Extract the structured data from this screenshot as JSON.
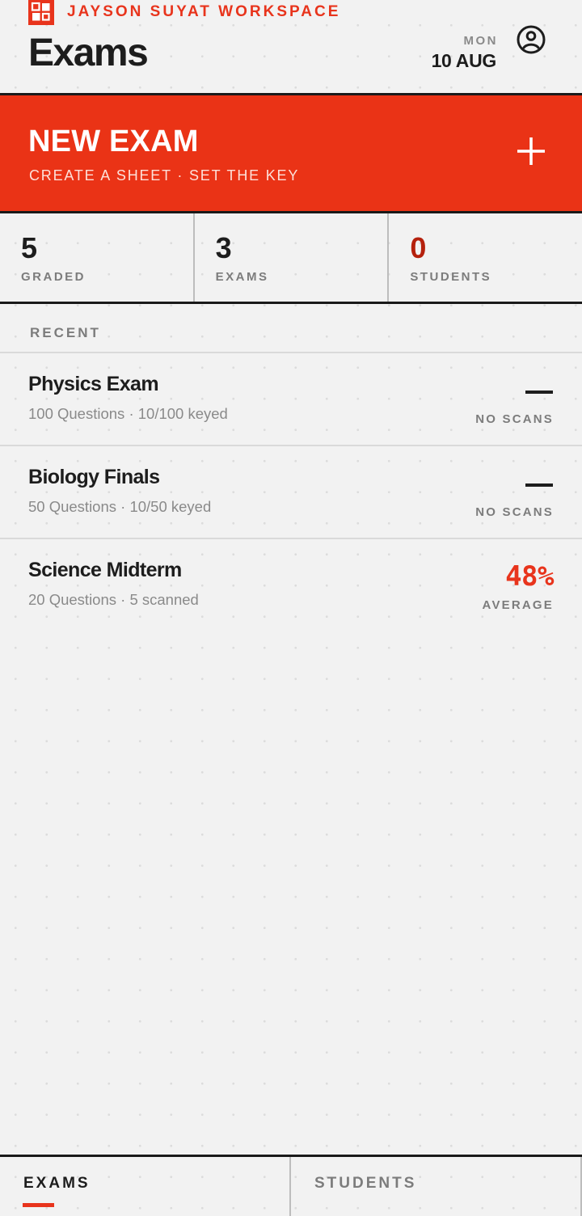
{
  "header": {
    "workspace": "JAYSON SUYAT WORKSPACE",
    "title": "Exams",
    "day": "MON",
    "date": "10 AUG",
    "logo_icon": "grid-logo-icon",
    "profile_icon": "account-circle-icon"
  },
  "banner": {
    "title": "NEW EXAM",
    "subtitle": "CREATE A SHEET · SET THE KEY",
    "action_icon": "plus-icon"
  },
  "stats": [
    {
      "value": "5",
      "label": "GRADED"
    },
    {
      "value": "3",
      "label": "EXAMS"
    },
    {
      "value": "0",
      "label": "STUDENTS"
    }
  ],
  "recent_label": "RECENT",
  "exams": [
    {
      "name": "Physics Exam",
      "meta": "100 Questions · 10/100 keyed",
      "status": "NO SCANS"
    },
    {
      "name": "Biology Finals",
      "meta": "50 Questions · 10/50 keyed",
      "status": "NO SCANS"
    },
    {
      "name": "Science Midterm",
      "meta": "20 Questions · 5 scanned",
      "score": "48%",
      "status": "AVERAGE"
    }
  ],
  "nav": {
    "exams": "EXAMS",
    "students": "STUDENTS"
  },
  "colors": {
    "accent": "#e8341c",
    "banner": "#ea3316",
    "ink": "#1d1d1d",
    "muted": "#7c7c7c",
    "background": "#f2f2f2"
  }
}
